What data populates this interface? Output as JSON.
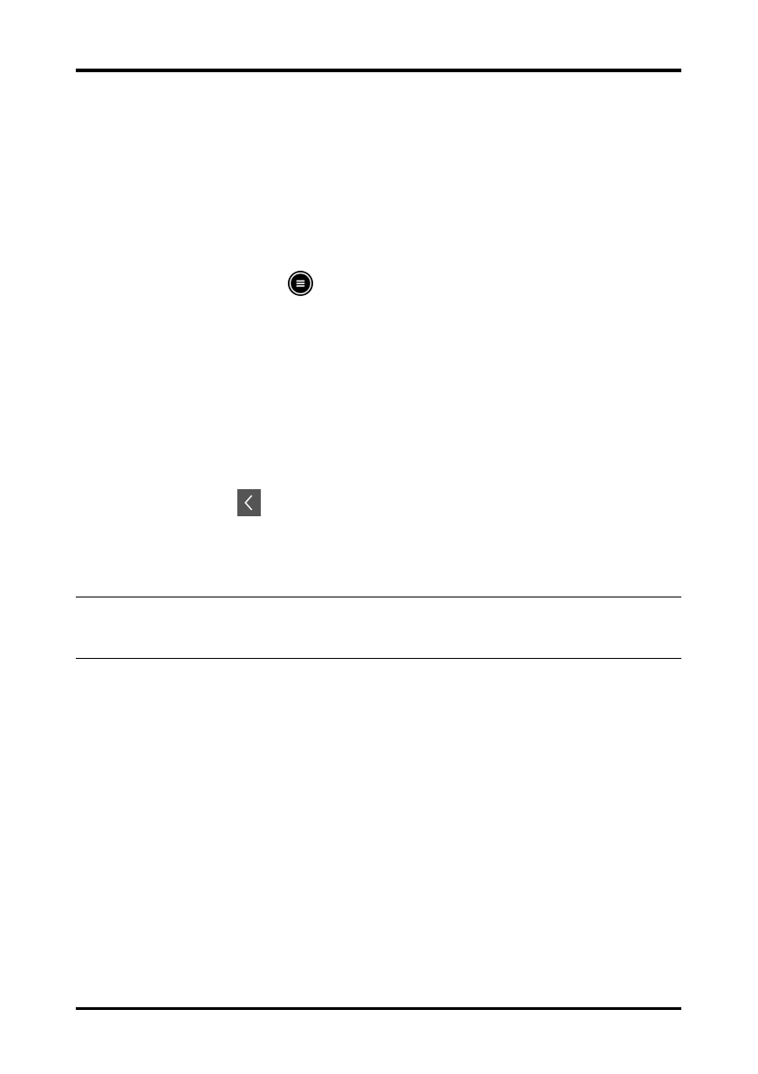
{
  "icons": {
    "menu": "menu-circle-icon",
    "back": "chevron-left-icon"
  },
  "colors": {
    "rule": "#000000",
    "menu_icon_fill": "#000000",
    "back_icon_fill": "#555555",
    "back_icon_stroke": "#ffffff"
  }
}
